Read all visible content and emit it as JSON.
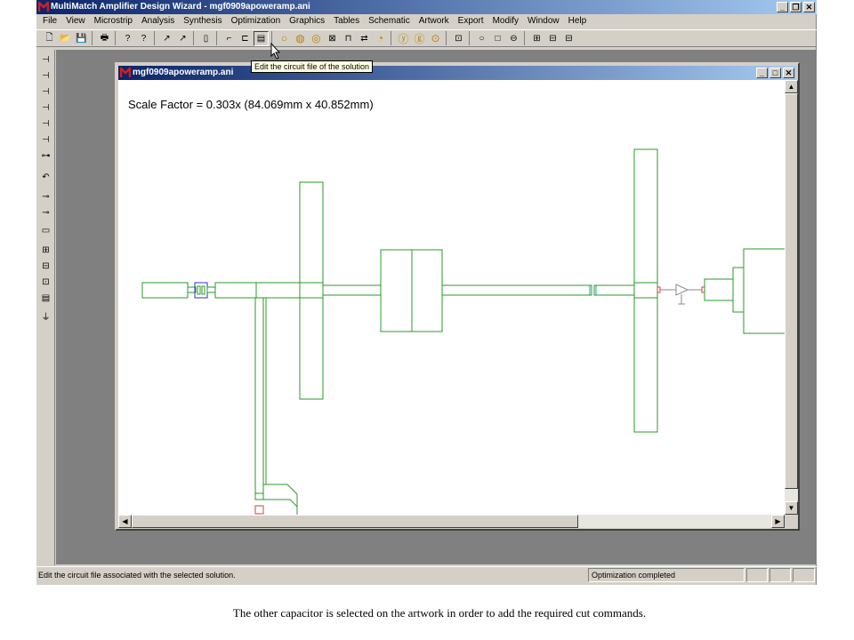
{
  "app": {
    "title": "MultiMatch Amplifier Design Wizard - mgf0909apoweramp.ani",
    "caption_buttons": [
      "_",
      "❐",
      "✕"
    ]
  },
  "menu": [
    "File",
    "View",
    "Microstrip",
    "Analysis",
    "Synthesis",
    "Optimization",
    "Graphics",
    "Tables",
    "Schematic",
    "Artwork",
    "Export",
    "Modify",
    "Window",
    "Help"
  ],
  "toolbar": {
    "tooltip": "Edit the circuit file of the solution"
  },
  "child_window": {
    "title": "mgf0909apoweramp.ani",
    "caption_buttons": [
      "_",
      "□",
      "✕"
    ],
    "scale_label": "Scale Factor =  0.303x (84.069mm x 40.852mm)"
  },
  "statusbar": {
    "message": "Edit the circuit file associated with the selected solution.",
    "status": "Optimization completed"
  },
  "caption": "The other capacitor is selected on the artwork in order to add the required cut commands.",
  "colors": {
    "titlebar_start": "#0a246a",
    "titlebar_end": "#a6caf0",
    "trace": "#2a9a2a",
    "selection": "#3030c0"
  }
}
